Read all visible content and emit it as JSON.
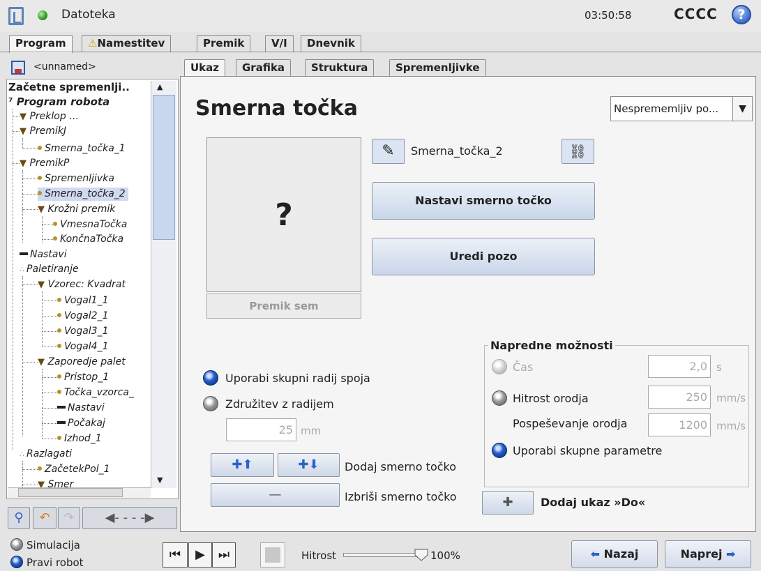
{
  "title_bar": {
    "file_menu": "Datoteka",
    "time": "03:50:58",
    "robot_name": "CCCC",
    "help": "?"
  },
  "main_tabs": [
    {
      "label": "Program"
    },
    {
      "label": "Namestitev"
    },
    {
      "label": "Premik"
    },
    {
      "label": "V/I"
    },
    {
      "label": "Dnevnik"
    }
  ],
  "program": {
    "name": "<unnamed>"
  },
  "tree": {
    "items": [
      "Začetne spremenlji..",
      "Program robota",
      "Preklop …",
      "PremikJ",
      "Smerna_točka_1",
      "PremikP",
      "Spremenljivka",
      "Smerna_točka_2",
      "Krožni premik",
      "VmesnaTočka",
      "KončnaTočka",
      "Nastavi",
      "Paletiranje",
      "Vzorec: Kvadrat",
      "Vogal1_1",
      "Vogal2_1",
      "Vogal3_1",
      "Vogal4_1",
      "Zaporedje palet",
      "Pristop_1",
      "Točka_vzorca_",
      "Nastavi",
      "Počakaj",
      "Izhod_1",
      "Razlagati",
      "ZačetekPol_1",
      "Smer"
    ]
  },
  "sub_tabs": [
    {
      "label": "Ukaz"
    },
    {
      "label": "Grafika"
    },
    {
      "label": "Struktura"
    },
    {
      "label": "Spremenljivke"
    }
  ],
  "waypoint": {
    "heading": "Smerna točka",
    "mode_select": "Nesprememljiv po...",
    "preview_placeholder": "?",
    "move_here": "Premik sem",
    "name": "Smerna_točka_2",
    "set_waypoint": "Nastavi smerno točko",
    "edit_pose": "Uredi pozo",
    "blend_shared": "Uporabi skupni radij spoja",
    "blend_radius": "Združitev z radijem",
    "blend_value": "25",
    "blend_unit": "mm",
    "add_waypoint": "Dodaj smerno točko",
    "delete_waypoint": "Izbriši smerno točko",
    "delete_symbol": "—",
    "add_until": "Dodaj ukaz »Do«"
  },
  "advanced": {
    "title": "Napredne možnosti",
    "time_label": "Čas",
    "time_value": "2,0",
    "time_unit": "s",
    "tool_speed_label": "Hitrost orodja",
    "tool_speed_value": "250",
    "tool_speed_unit": "mm/s",
    "tool_accel_label": "Pospeševanje orodja",
    "tool_accel_value": "1200",
    "tool_accel_unit": "mm/s",
    "shared_params_label": "Uporabi skupne parametre"
  },
  "footer": {
    "simulation": "Simulacija",
    "real_robot": "Pravi robot",
    "speed_label": "Hitrost",
    "speed_value": "100%",
    "speed_fraction": 1.0,
    "back": "Nazaj",
    "next": "Naprej"
  }
}
